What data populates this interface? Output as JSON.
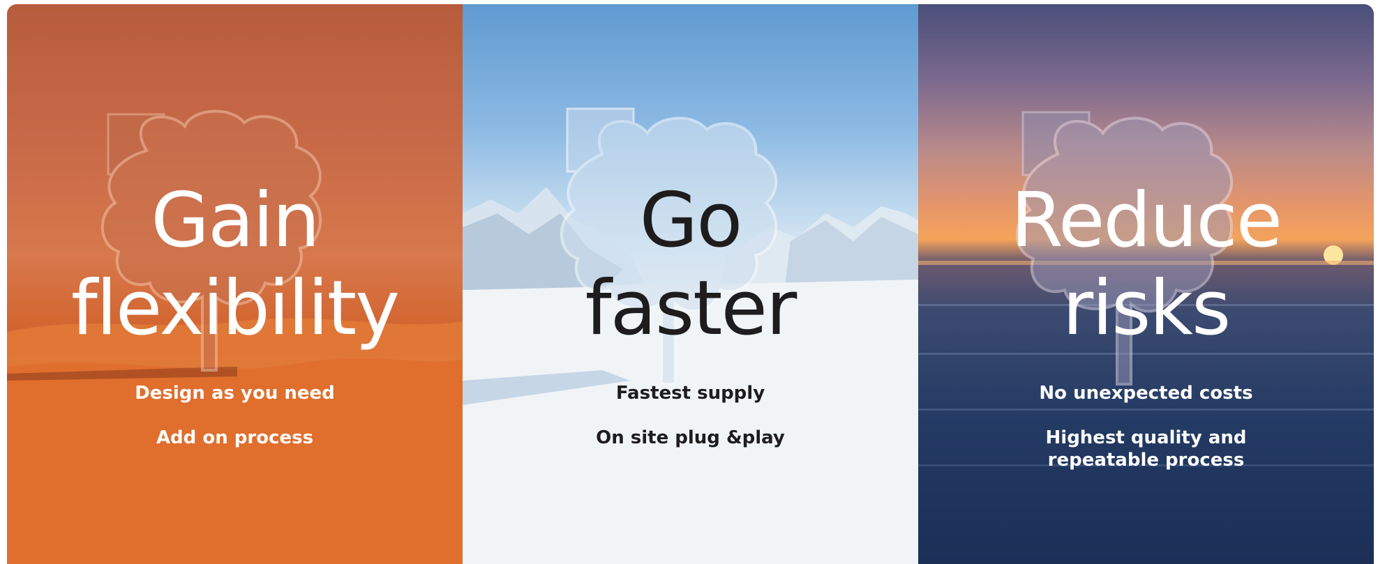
{
  "panels": [
    {
      "headline_line1": "Gain",
      "headline_line2": "flexibility",
      "point1": "Design as you need",
      "point2": "Add on process"
    },
    {
      "headline_line1": "Go",
      "headline_line2": "faster",
      "point1": "Fastest supply",
      "point2": "On site plug &play"
    },
    {
      "headline_line1": "Reduce",
      "headline_line2": "risks",
      "point1": "No unexpected costs",
      "point2_line1": "Highest quality and",
      "point2_line2": "repeatable process"
    }
  ],
  "colors": {
    "desert": "#d2652f",
    "sky": "#8cb9e3",
    "ocean": "#233a63",
    "light_text": "#ffffff",
    "dark_text": "#1e1c1c"
  },
  "icons": [
    "cloud-sculpture-icon",
    "cloud-sculpture-icon",
    "cloud-sculpture-icon"
  ]
}
